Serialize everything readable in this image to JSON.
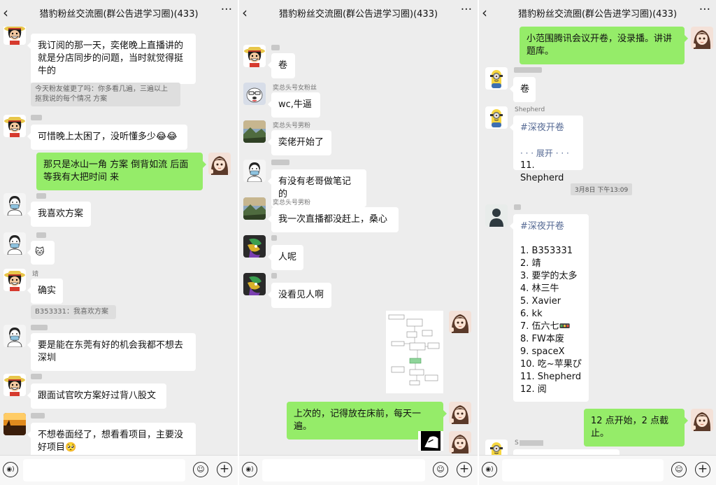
{
  "chat_title": "猎豹粉丝交流圈(群公告进学习圈)(433)",
  "icons": {
    "back": "back-chevron-icon",
    "more": "more-dots-icon",
    "voice": "voice-icon",
    "emoji": "emoji-icon",
    "plus": "plus-icon"
  },
  "colors": {
    "sent_bubble": "#95ec69",
    "received_bubble": "#ffffff",
    "background": "#ededed",
    "link": "#576b95"
  },
  "p1": {
    "m1": "我订阅的那一天，奕佬晚上直播讲的就是分店同步的问题，当时就觉得挺牛的",
    "q1": "今天粉友催更了吗：你多看几遍，三遍以上 抠我说的每个情况 方案",
    "m2": "可惜晚上太困了，没听懂多少😂😂",
    "m3": "那只是冰山一角 方案 倒背如流 后面等我有大把时间 来",
    "m4": "我喜欢方案",
    "m5": "🐱",
    "n6": "靖",
    "m6": "确实",
    "q2": "B353331：我喜欢方案",
    "m7": "要是能在东莞有好的机会我都不想去深圳",
    "m8": "跟面试官吹方案好过背八股文",
    "m9": "不想卷面经了，想看看项目，主要没好项目🥺"
  },
  "p2": {
    "m1": "卷",
    "n2": "奕总头号女粉丝",
    "m2": "wc,牛逼",
    "n3": "奕总头号男粉",
    "m3": "奕佬开始了",
    "m4": "有没有老哥做笔记的",
    "n5": "奕总头号男粉",
    "m5": "我一次直播都没赶上，桑心",
    "m6": "人呢",
    "m7": "没看见人啊",
    "m8": "上次的，记得放在床前，每天一遍。"
  },
  "p3": {
    "m1": "小范围腾讯会议开卷，没录播。讲讲题库。",
    "m2": "卷",
    "n3": "Shepherd",
    "m3_tag": "#深夜开卷",
    "m3_expand": "· · · 展开 · · ·",
    "m3_last": "11. Shepherd",
    "time": "3月8日 下午13:09",
    "m4_tag": "#深夜开卷",
    "list": [
      "1. B353331",
      "2. 靖",
      "3. 要学的太多",
      "4. 林三牛",
      "5. Xavier",
      "6. kk",
      "7. 伍六七🚥",
      "8. FW本废",
      "9. spaceX",
      "10. 吃~苹果ぴ",
      "11. Shepherd",
      "12. 阅"
    ],
    "m5": "12 点开始，2 点截止。",
    "n6": "S"
  }
}
